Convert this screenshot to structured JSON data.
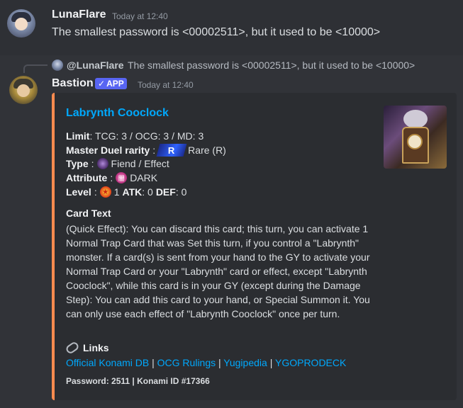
{
  "message1": {
    "username": "LunaFlare",
    "timestamp": "Today at 12:40",
    "content": "The smallest password is <00002511>, but it used to be <10000>"
  },
  "reply": {
    "username": "@LunaFlare",
    "text": "The smallest password is <00002511>, but it used to be <10000>"
  },
  "message2": {
    "username": "Bastion",
    "badge": "APP",
    "timestamp": "Today at 12:40"
  },
  "embed": {
    "accent_color": "#ff8b4f",
    "title": "Labrynth Cooclock",
    "limit_label": "Limit",
    "limit_value": ": TCG: 3 / OCG: 3 / MD: 3",
    "rarity_label": "Master Duel rarity",
    "rarity_icon_text": "R",
    "rarity_value": "Rare (R)",
    "type_label": "Type",
    "type_value": "Fiend / Effect",
    "attribute_label": "Attribute",
    "attribute_icon_text": "闇",
    "attribute_value": "DARK",
    "level_label": "Level",
    "level_value": "1",
    "atk_label": "ATK",
    "atk_value": ": 0",
    "def_label": "DEF",
    "def_value": ": 0",
    "card_text_heading": "Card Text",
    "card_text": "(Quick Effect): You can discard this card; this turn, you can activate 1 Normal Trap Card that was Set this turn, if you control a \"Labrynth\" monster. If a card(s) is sent from your hand to the GY to activate your Normal Trap Card or your \"Labrynth\" card or effect, except \"Labrynth Cooclock\", while this card is in your GY (except during the Damage Step): You can add this card to your hand, or Special Summon it. You can only use each effect of \"Labrynth Cooclock\" once per turn.",
    "links_heading": "Links",
    "links": [
      "Official Konami DB",
      "OCG Rulings",
      "Yugipedia",
      "YGOPRODECK"
    ],
    "link_separator": " | ",
    "footer": "Password: 2511 | Konami ID #17366"
  }
}
